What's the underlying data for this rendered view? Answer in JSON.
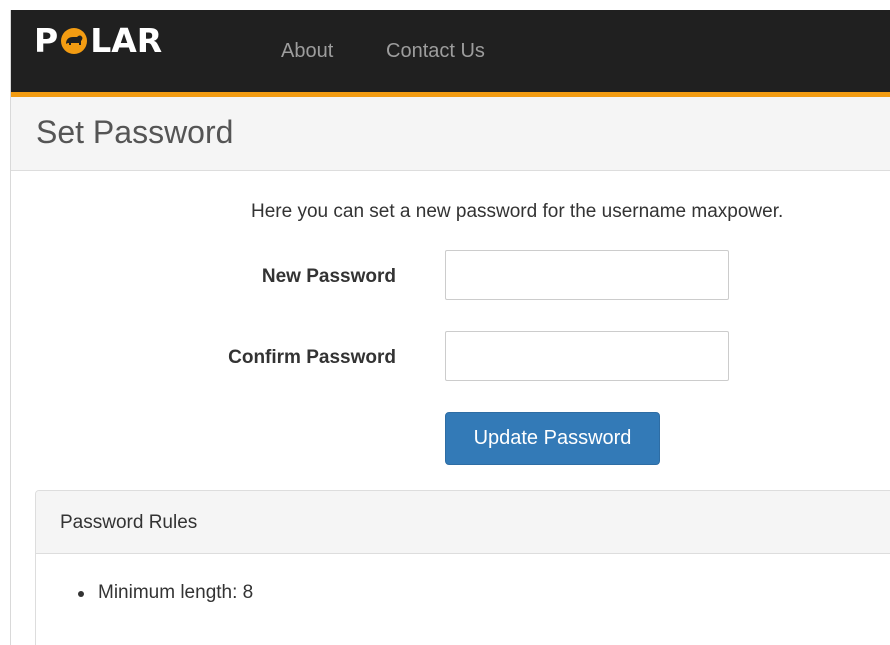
{
  "brand": {
    "logo_text_left": "P",
    "logo_text_right": "LAR",
    "logo_icon": "bear-in-orange-circle-icon",
    "accent_color": "#f39c12",
    "navbar_color": "#202020"
  },
  "nav": {
    "items": [
      {
        "label": "About"
      },
      {
        "label": "Contact Us"
      }
    ]
  },
  "page": {
    "title": "Set Password"
  },
  "form": {
    "intro": "Here you can set a new password for the username maxpower.",
    "new_password_label": "New Password",
    "new_password_value": "",
    "confirm_password_label": "Confirm Password",
    "confirm_password_value": "",
    "submit_label": "Update Password",
    "submit_color": "#337ab7"
  },
  "rules": {
    "heading": "Password Rules",
    "items": [
      {
        "text": "Minimum length: 8"
      }
    ]
  }
}
